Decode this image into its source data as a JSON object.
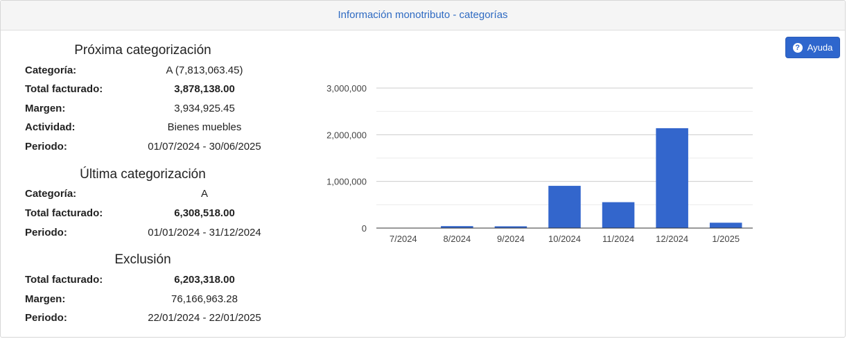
{
  "header": {
    "title": "Información monotributo - categorías"
  },
  "help_button": {
    "label": "Ayuda"
  },
  "proxima": {
    "title": "Próxima categorización",
    "rows": [
      {
        "label": "Categoría:",
        "value": "A (7,813,063.45)"
      },
      {
        "label": "Total facturado:",
        "value": "3,878,138.00"
      },
      {
        "label": "Margen:",
        "value": "3,934,925.45"
      },
      {
        "label": "Actividad:",
        "value": "Bienes muebles"
      },
      {
        "label": "Periodo:",
        "value": "01/07/2024 - 30/06/2025"
      }
    ]
  },
  "ultima": {
    "title": "Última categorización",
    "rows": [
      {
        "label": "Categoría:",
        "value": "A"
      },
      {
        "label": "Total facturado:",
        "value": "6,308,518.00"
      },
      {
        "label": "Periodo:",
        "value": "01/01/2024 - 31/12/2024"
      }
    ]
  },
  "exclusion": {
    "title": "Exclusión",
    "rows": [
      {
        "label": "Total facturado:",
        "value": "6,203,318.00"
      },
      {
        "label": "Margen:",
        "value": "76,166,963.28"
      },
      {
        "label": "Periodo:",
        "value": "22/01/2024 - 22/01/2025"
      }
    ]
  },
  "colors": {
    "accent": "#2e66cd",
    "bar": "#3366cc",
    "heading_text": "#2e6ac2"
  },
  "chart_data": {
    "type": "bar",
    "categories": [
      "7/2024",
      "8/2024",
      "9/2024",
      "10/2024",
      "11/2024",
      "12/2024",
      "1/2025"
    ],
    "values": [
      5000,
      42000,
      38000,
      905000,
      555000,
      2140000,
      115000
    ],
    "ylim": [
      0,
      3000000
    ],
    "y_ticks": [
      "0",
      "1,000,000",
      "2,000,000",
      "3,000,000"
    ],
    "y_tick_values": [
      0,
      1000000,
      2000000,
      3000000
    ],
    "grid": true,
    "legend": "none"
  }
}
